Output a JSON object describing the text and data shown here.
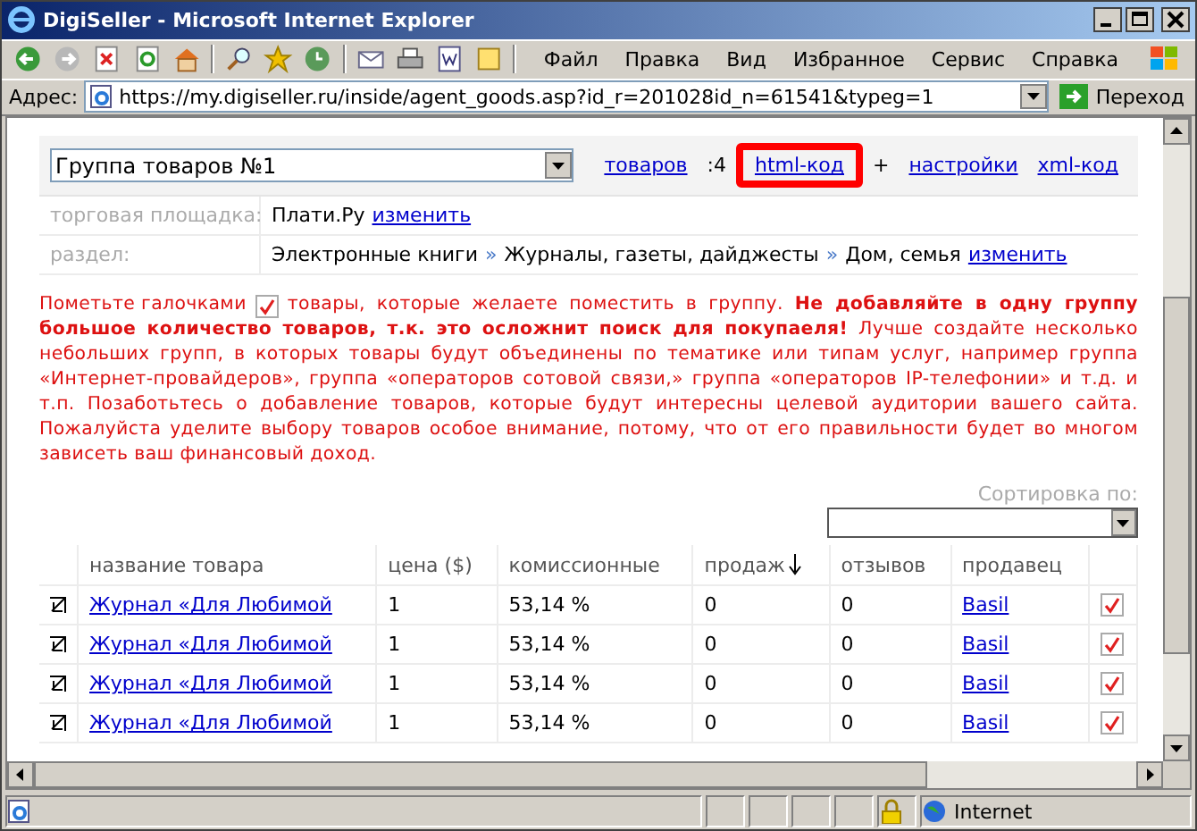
{
  "window": {
    "title": "DigiSeller - Microsoft Internet Explorer"
  },
  "menu": [
    "Файл",
    "Правка",
    "Вид",
    "Избранное",
    "Сервис",
    "Справка"
  ],
  "address": {
    "label": "Адрес:",
    "value": "https://my.digiseller.ru/inside/agent_goods.asp?id_r=201028id_n=61541&typeg=1",
    "go": "Переход"
  },
  "group": {
    "value": "Группа товаров №1",
    "links": [
      {
        "kind": "link",
        "text": "товаров",
        "highlighted": false
      },
      {
        "kind": "text",
        "text": ":4",
        "highlighted": false
      },
      {
        "kind": "link",
        "text": "html-код",
        "highlighted": true
      },
      {
        "kind": "text",
        "text": "+",
        "highlighted": false
      },
      {
        "kind": "link",
        "text": "настройки",
        "highlighted": false
      },
      {
        "kind": "link",
        "text": "xml-код",
        "highlighted": false
      }
    ]
  },
  "info_rows": [
    {
      "label": "торговая площадка:",
      "parts": [
        {
          "kind": "text",
          "text": "Плати.Ру"
        },
        {
          "kind": "link",
          "text": "изменить"
        }
      ]
    },
    {
      "label": "раздел:",
      "parts": [
        {
          "kind": "text",
          "text": "Электронные книги"
        },
        {
          "kind": "separator",
          "text": "»"
        },
        {
          "kind": "text",
          "text": "Журналы, газеты, дайджесты"
        },
        {
          "kind": "separator",
          "text": "»"
        },
        {
          "kind": "text",
          "text": "Дом, семья"
        },
        {
          "kind": "link",
          "text": "изменить"
        }
      ]
    }
  ],
  "notice": {
    "before": "Пометьте галочками",
    "first_line": "товары, которые желаете поместить в группу. **Не добавляйте в одну группу**",
    "after": "**большое количество товаров, т.к. это осложнит поиск для покупаеля!** Лучше создайте несколько небольших групп, в которых товары будут объединены по тематике или типам услуг, например группа «Интернет-провайдеров», группа «операторов сотовой связи,» группа «операторов IP-телефонии» и т.д. и т.п. Позаботьтесь о добавление товаров, которые будут интересны целевой аудитории вашего сайта. Пожалуйста уделите выбору товаров особое внимание, потому, что от его правильности будет во многом зависеть ваш финансовый доход."
  },
  "sort": {
    "label": "Сортировка по:"
  },
  "table": {
    "columns": [
      {
        "label": "название товара",
        "sorted": false
      },
      {
        "label": "цена ($)",
        "sorted": false
      },
      {
        "label": "комиссионные",
        "sorted": false
      },
      {
        "label": "продаж",
        "sorted": true
      },
      {
        "label": "отзывов",
        "sorted": false
      },
      {
        "label": "продавец",
        "sorted": false
      }
    ],
    "rows": [
      {
        "name": "Журнал «Для Любимой",
        "price": "1",
        "commission": "53,14 %",
        "sales": "0",
        "reviews": "0",
        "seller": "Basil",
        "checked": true
      },
      {
        "name": "Журнал «Для Любимой",
        "price": "1",
        "commission": "53,14 %",
        "sales": "0",
        "reviews": "0",
        "seller": "Basil",
        "checked": true
      },
      {
        "name": "Журнал «Для Любимой",
        "price": "1",
        "commission": "53,14 %",
        "sales": "0",
        "reviews": "0",
        "seller": "Basil",
        "checked": true
      },
      {
        "name": "Журнал «Для Любимой",
        "price": "1",
        "commission": "53,14 %",
        "sales": "0",
        "reviews": "0",
        "seller": "Basil",
        "checked": true
      }
    ]
  },
  "status": {
    "zone": "Internet"
  }
}
